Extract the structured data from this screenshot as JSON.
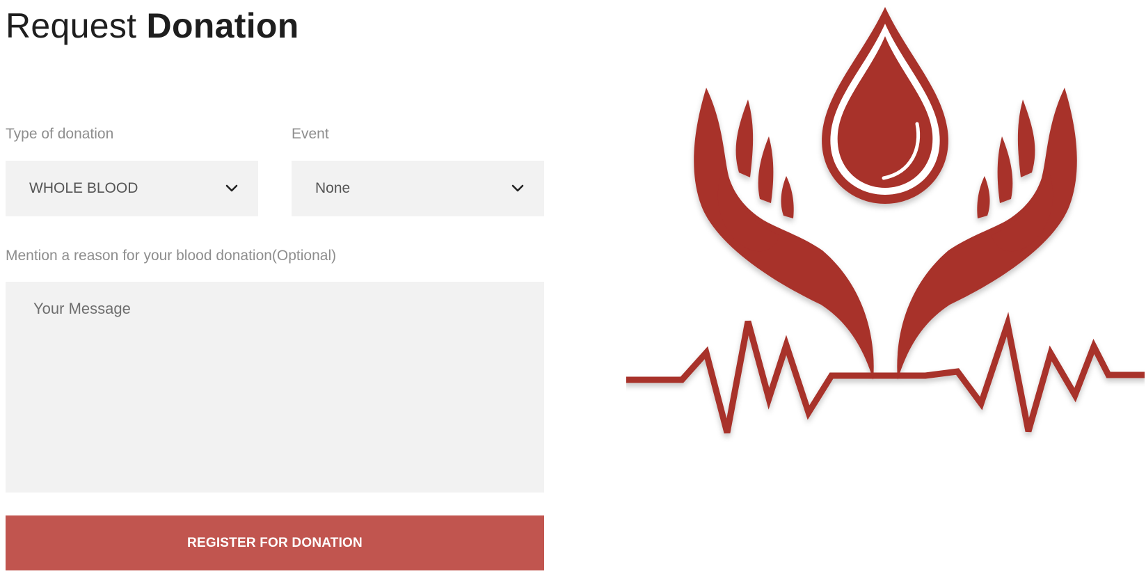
{
  "heading": {
    "light": "Request",
    "bold": "Donation"
  },
  "form": {
    "donation_type": {
      "label": "Type of donation",
      "selected": "WHOLE BLOOD"
    },
    "event": {
      "label": "Event",
      "selected": "None"
    },
    "reason": {
      "label": "Mention a reason for your blood donation(Optional)",
      "placeholder": "Your Message",
      "value": ""
    },
    "submit_label": "REGISTER FOR DONATION"
  },
  "colors": {
    "accent": "#c1554f",
    "logo_red": "#a8302a",
    "field_bg": "#f2f2f2",
    "label": "#8e8e8e"
  },
  "icons": {
    "select_arrow": "chevron-down-icon",
    "logo": "blood-donation-logo"
  }
}
